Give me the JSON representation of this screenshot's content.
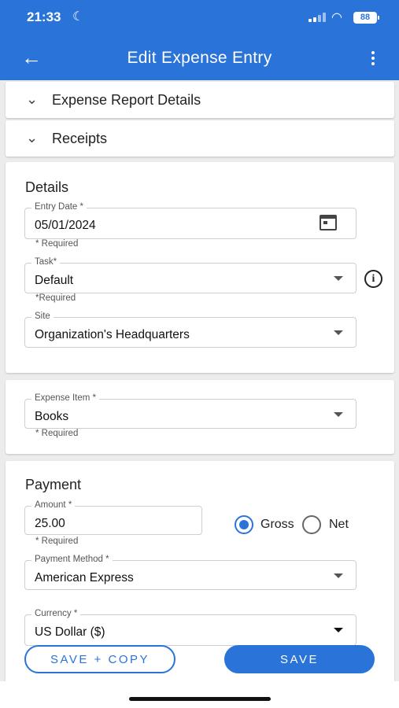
{
  "status_bar": {
    "time": "21:33",
    "battery": "88"
  },
  "app_bar": {
    "title": "Edit Expense Entry"
  },
  "sections": {
    "report_details": "Expense Report Details",
    "receipts": "Receipts"
  },
  "details": {
    "title": "Details",
    "entry_date": {
      "label": "Entry Date *",
      "value": "05/01/2024",
      "helper": "* Required"
    },
    "task": {
      "label": "Task*",
      "value": "Default",
      "helper": "*Required"
    },
    "site": {
      "label": "Site",
      "value": "Organization's Headquarters"
    }
  },
  "expense_item": {
    "label": "Expense Item *",
    "value": "Books",
    "helper": "* Required"
  },
  "payment": {
    "title": "Payment",
    "amount": {
      "label": "Amount *",
      "value": "25.00",
      "helper": "* Required"
    },
    "gross_label": "Gross",
    "net_label": "Net",
    "selected": "Gross",
    "method": {
      "label": "Payment Method *",
      "value": "American Express"
    },
    "currency": {
      "label": "Currency *",
      "value": "US Dollar ($)"
    }
  },
  "buttons": {
    "save_copy": "SAVE + COPY",
    "save": "SAVE"
  },
  "colors": {
    "primary": "#2a73d9",
    "background": "#ececec"
  }
}
